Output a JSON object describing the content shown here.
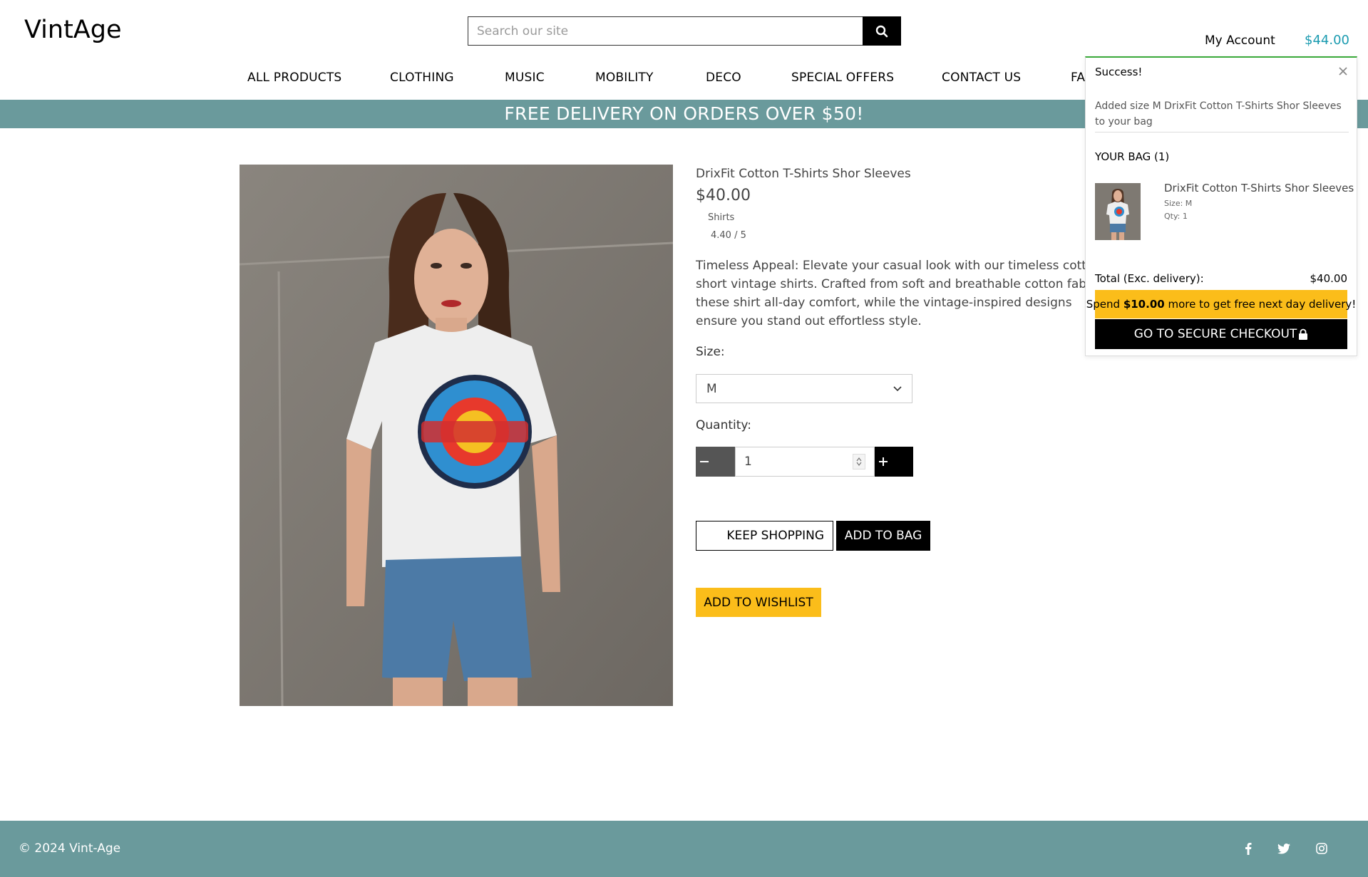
{
  "header": {
    "logo": "VintAge",
    "search_placeholder": "Search our site",
    "account_label": "My Account",
    "bag_total": "$44.00"
  },
  "nav": [
    "ALL PRODUCTS",
    "CLOTHING",
    "MUSIC",
    "MOBILITY",
    "DECO",
    "SPECIAL OFFERS",
    "CONTACT US",
    "FA"
  ],
  "banner": "FREE DELIVERY ON ORDERS OVER $50!",
  "product": {
    "name": "DrixFit Cotton T-Shirts Shor Sleeves",
    "price": "$40.00",
    "category": "Shirts",
    "rating": "4.40 / 5",
    "description": "Timeless Appeal: Elevate your casual look with our timeless cotton short vintage shirts. Crafted from soft and breathable cotton fabric, these shirt all-day comfort, while the vintage-inspired designs ensure you stand out effortless style.",
    "size_label": "Size:",
    "size_value": "M",
    "quantity_label": "Quantity:",
    "quantity_value": "1",
    "keep_shopping": "KEEP SHOPPING",
    "add_to_bag": "ADD TO BAG",
    "add_to_wishlist": "ADD TO WISHLIST"
  },
  "popup": {
    "title": "Success!",
    "message": "Added size M DrixFit Cotton T-Shirts Shor Sleeves to your bag",
    "bag_heading": "YOUR BAG (1)",
    "item_name": "DrixFit Cotton T-Shirts Shor Sleeves",
    "item_size": "Size: M",
    "item_qty": "Qty: 1",
    "total_label": "Total (Exc. delivery):",
    "total_value": "$40.00",
    "promo_pre": "Spend ",
    "promo_amount": "$10.00",
    "promo_post": " more to get free next day delivery!",
    "checkout": "GO TO SECURE CHECKOUT"
  },
  "footer": {
    "copyright": "© 2024 Vint-Age"
  },
  "colors": {
    "teal": "#6a9a9c",
    "accent_blue": "#1b9bb0",
    "yellow": "#fbbd1a",
    "success_green": "#3aa93a"
  },
  "icons": [
    "search-icon",
    "close-icon",
    "lock-icon",
    "facebook-icon",
    "twitter-icon",
    "instagram-icon",
    "chevron-down-icon"
  ]
}
